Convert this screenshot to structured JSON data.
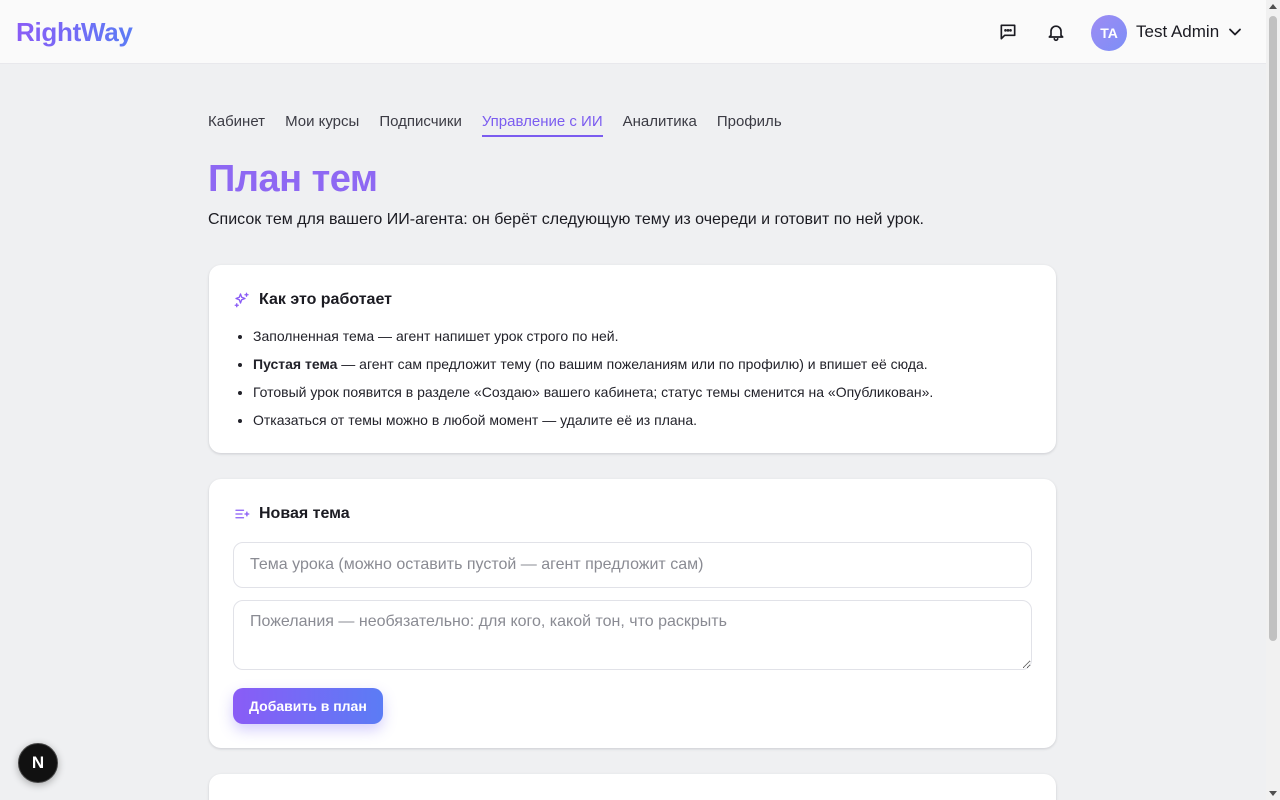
{
  "header": {
    "logo": "RightWay",
    "user_initials": "TA",
    "user_name": "Test Admin",
    "icons": [
      "chat-icon",
      "bell-icon",
      "chevron-down-icon"
    ]
  },
  "tabs": [
    {
      "label": "Кабинет",
      "active": false
    },
    {
      "label": "Мои курсы",
      "active": false
    },
    {
      "label": "Подписчики",
      "active": false
    },
    {
      "label": "Управление с ИИ",
      "active": true
    },
    {
      "label": "Аналитика",
      "active": false
    },
    {
      "label": "Профиль",
      "active": false
    }
  ],
  "page": {
    "title": "План тем",
    "subtitle": "Список тем для вашего ИИ-агента: он берёт следующую тему из очереди и готовит по ней урок."
  },
  "how_it_works": {
    "title": "Как это работает",
    "icon": "sparkles-icon",
    "items": [
      {
        "strong": "",
        "text": "Заполненная тема — агент напишет урок строго по ней."
      },
      {
        "strong": "Пустая тема",
        "text": " — агент сам предложит тему (по вашим пожеланиям или по профилю) и впишет её сюда."
      },
      {
        "strong": "",
        "text": "Готовый урок появится в разделе «Создаю» вашего кабинета; статус темы сменится на «Опубликован»."
      },
      {
        "strong": "",
        "text": "Отказаться от темы можно в любой момент — удалите её из плана."
      }
    ]
  },
  "new_topic": {
    "title": "Новая тема",
    "icon": "list-plus-icon",
    "topic_value": "",
    "topic_placeholder": "Тема урока (можно оставить пустой — агент предложит сам)",
    "wishes_value": "",
    "wishes_placeholder": "Пожелания — необязательно: для кого, какой тон, что раскрыть",
    "submit_label": "Добавить в план"
  },
  "dev_badge": "N",
  "colors": {
    "accent": "#7b5cf0",
    "title": "#8e68f3",
    "gradient_start": "#8a5cf6",
    "gradient_end": "#5b7cf5",
    "background": "#eff0f2"
  }
}
